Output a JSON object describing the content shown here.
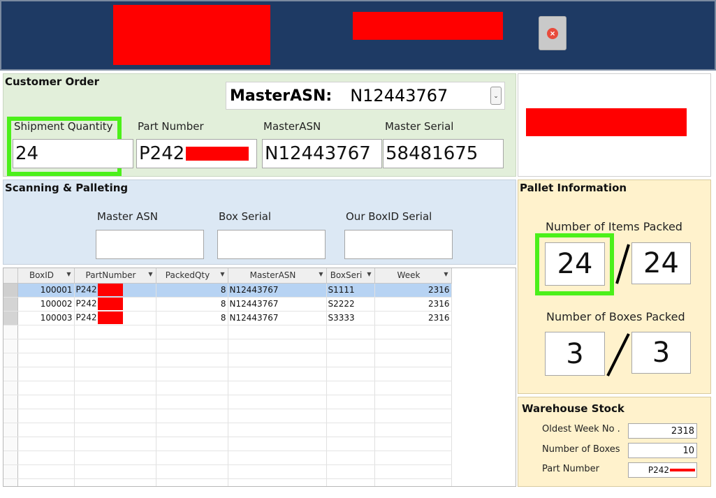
{
  "close_icon": "close-icon",
  "customer_order": {
    "title": "Customer Order",
    "master_asn_label": "MasterASN:",
    "master_asn_value": "N12443767",
    "dropdown_icon": "chevron-down-icon",
    "fields": {
      "shipment_quantity_label": "Shipment Quantity",
      "shipment_quantity_value": "24",
      "part_number_label": "Part Number",
      "part_number_value": "P242",
      "master_asn_label": "MasterASN",
      "master_asn_value": "N12443767",
      "master_serial_label": "Master Serial",
      "master_serial_value": "58481675"
    }
  },
  "scanning": {
    "title": "Scanning & Palleting",
    "master_asn_label": "Master ASN",
    "box_serial_label": "Box Serial",
    "our_boxid_label": "Our BoxID Serial"
  },
  "grid": {
    "columns": [
      "BoxID",
      "PartNumber",
      "PackedQty",
      "MasterASN",
      "BoxSeri",
      "Week"
    ],
    "rows": [
      {
        "boxid": "100001",
        "part": "P242",
        "qty": "8",
        "asn": "N12443767",
        "serial": "S1111",
        "week": "2316"
      },
      {
        "boxid": "100002",
        "part": "P242",
        "qty": "8",
        "asn": "N12443767",
        "serial": "S2222",
        "week": "2316"
      },
      {
        "boxid": "100003",
        "part": "P242",
        "qty": "8",
        "asn": "N12443767",
        "serial": "S3333",
        "week": "2316"
      }
    ]
  },
  "pallet": {
    "title": "Pallet Information",
    "items_label": "Number of Items Packed",
    "items_packed": "24",
    "items_total": "24",
    "boxes_label": "Number of Boxes Packed",
    "boxes_packed": "3",
    "boxes_total": "3"
  },
  "warehouse": {
    "title": "Warehouse Stock",
    "oldest_week_label": "Oldest Week No .",
    "oldest_week_value": "2318",
    "boxes_label": "Number of Boxes",
    "boxes_value": "10",
    "part_label": "Part Number",
    "part_value": "P242"
  },
  "colors": {
    "header": "#1e3a64",
    "highlight": "#4cf01a",
    "redaction": "#ff0000",
    "selected_row": "#b7d3f3"
  }
}
